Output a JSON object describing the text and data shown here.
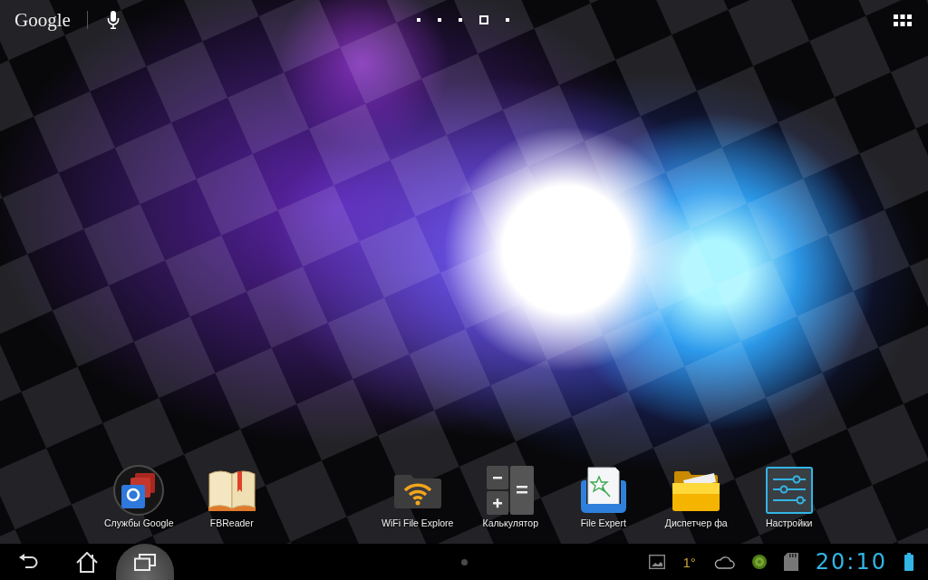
{
  "search_bar": {
    "logo": "Google"
  },
  "page_indicator": [
    {
      "selected": false
    },
    {
      "selected": false
    },
    {
      "selected": false
    },
    {
      "selected": true
    },
    {
      "selected": false
    }
  ],
  "dock": [
    {
      "kind": "google",
      "label": "Службы Google"
    },
    {
      "kind": "reader",
      "label": "FBReader"
    },
    {
      "kind": "wifi",
      "label": "WiFi File Explore"
    },
    {
      "kind": "calculator",
      "label": "Калькулятор"
    },
    {
      "kind": "expert",
      "label": "File Expert"
    },
    {
      "kind": "folder",
      "label": "Диспетчер фа"
    },
    {
      "kind": "settings",
      "label": "Настройки"
    }
  ],
  "nav_bar": {
    "buttons": [
      {
        "kind": "back",
        "pressed": false
      },
      {
        "kind": "home",
        "pressed": false
      },
      {
        "kind": "recent",
        "pressed": true
      }
    ]
  },
  "status_bar": {
    "weather": "1°",
    "time": "20:10"
  }
}
